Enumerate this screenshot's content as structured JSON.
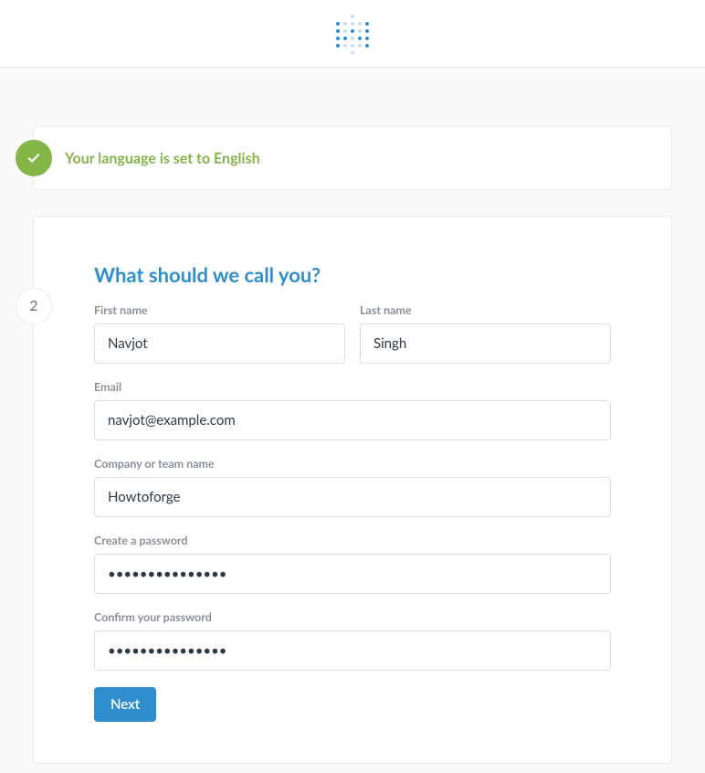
{
  "step1": {
    "title": "Your language is set to English"
  },
  "step2": {
    "number": "2",
    "title": "What should we call you?",
    "labels": {
      "first_name": "First name",
      "last_name": "Last name",
      "email": "Email",
      "company": "Company or team name",
      "password": "Create a password",
      "confirm_password": "Confirm your password"
    },
    "values": {
      "first_name": "Navjot",
      "last_name": "Singh",
      "email": "navjot@example.com",
      "company": "Howtoforge",
      "password": "•••••••••••••••",
      "confirm_password": "•••••••••••••••"
    },
    "next_label": "Next"
  }
}
